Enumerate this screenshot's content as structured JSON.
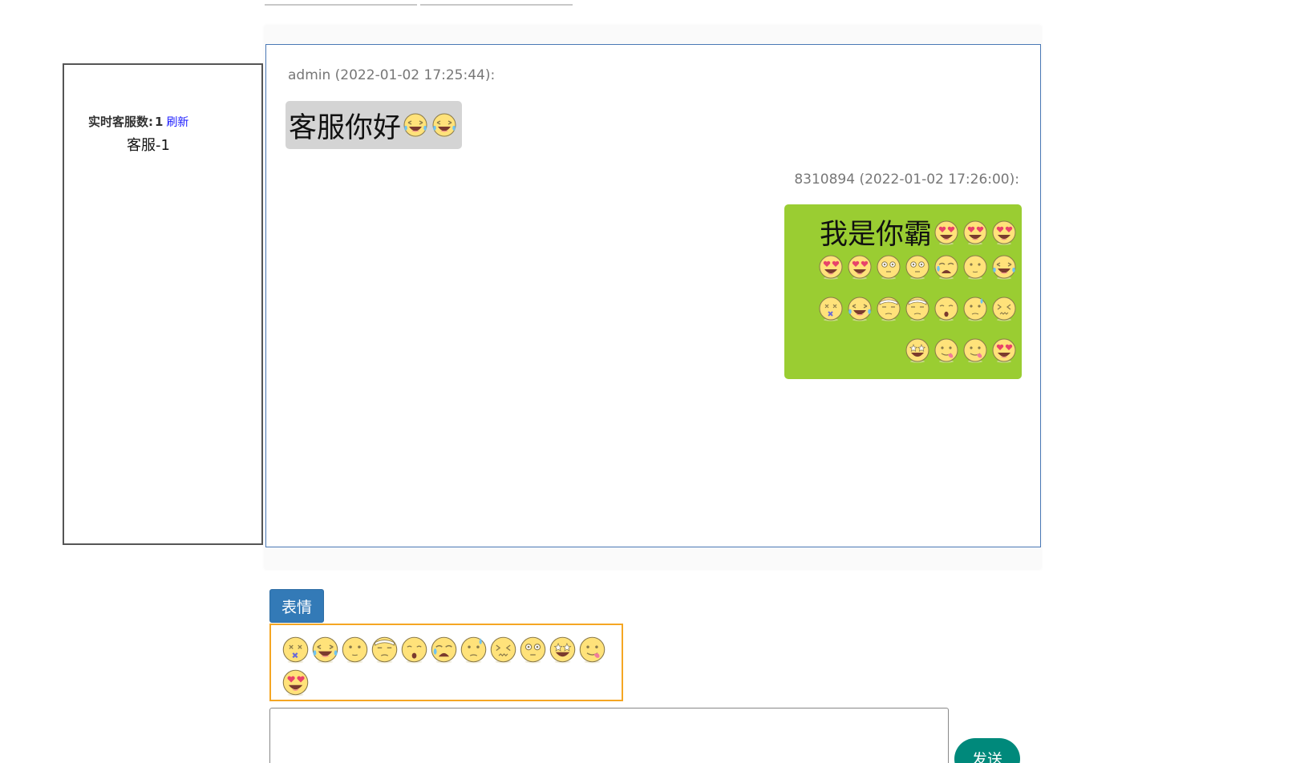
{
  "online_panel": {
    "label": "实时客服数:",
    "count": "1",
    "refresh_label": "刷新",
    "agents": [
      "客服-1"
    ]
  },
  "messages": [
    {
      "side": "left",
      "sender_meta": "admin (2022-01-02 17:25:44):",
      "text": "客服你好",
      "emojis": [
        "laugh-cry-icon",
        "laugh-cry-icon"
      ]
    },
    {
      "side": "right",
      "sender_meta": "8310894 (2022-01-02 17:26:00):",
      "text": "我是你霸",
      "emoji_lines": [
        [
          "heart-eyes-icon",
          "heart-eyes-icon",
          "heart-eyes-icon"
        ],
        [
          "heart-eyes-icon",
          "heart-eyes-icon",
          "wide-eyes-icon",
          "wide-eyes-icon",
          "sob-icon",
          "neutral-icon",
          "laugh-cry-icon"
        ],
        [
          "dizzy-icon",
          "laugh-cry-icon",
          "headband-icon",
          "headband-icon",
          "surprised-icon",
          "sweat-icon",
          "confounded-icon"
        ],
        [
          "star-eyes-icon",
          "tongue-icon",
          "tongue-icon",
          "heart-eyes-icon"
        ]
      ]
    }
  ],
  "toolbar": {
    "emoji_button_label": "表情"
  },
  "emoji_panel": [
    "dizzy-icon",
    "laugh-cry-icon",
    "neutral-icon",
    "headband-icon",
    "surprised-icon",
    "sob-icon",
    "sweat-icon",
    "confounded-icon",
    "wide-eyes-icon",
    "star-eyes-icon",
    "tongue-icon",
    "heart-eyes-icon"
  ],
  "composer": {
    "value": "",
    "send_label": "发送"
  },
  "colors": {
    "left_bubble": "#d4d4d4",
    "right_bubble": "#9acd32",
    "emoji_button": "#337ab7",
    "emoji_panel_border": "#f5a623",
    "send_button": "#00897b",
    "chat_border": "#4a78b5"
  }
}
